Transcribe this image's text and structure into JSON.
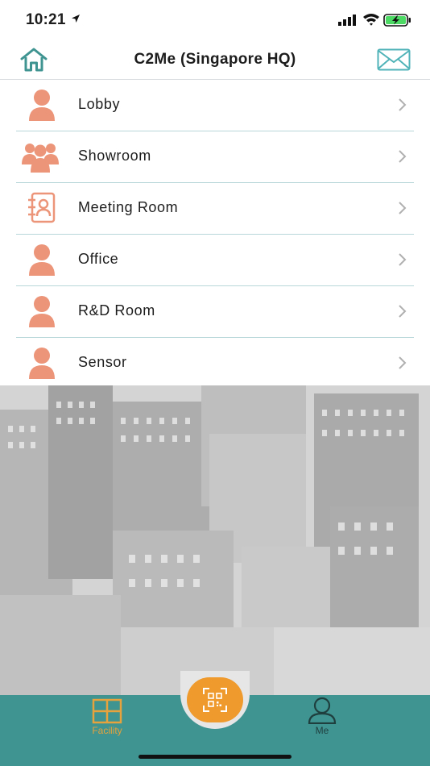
{
  "status_bar": {
    "time": "10:21"
  },
  "nav": {
    "title": "C2Me (Singapore HQ)"
  },
  "list": {
    "items": [
      {
        "label": "Lobby",
        "icon": "person-icon"
      },
      {
        "label": "Showroom",
        "icon": "group-icon"
      },
      {
        "label": "Meeting Room",
        "icon": "contact-book-icon"
      },
      {
        "label": "Office",
        "icon": "person-icon"
      },
      {
        "label": "R&D Room",
        "icon": "person-icon"
      },
      {
        "label": "Sensor",
        "icon": "person-icon"
      }
    ]
  },
  "tabs": {
    "facility_label": "Facility",
    "me_label": "Me",
    "active": "Facility"
  },
  "colors": {
    "accent": "#3f9491",
    "icon": "#ec9579",
    "active_tab": "#e5a23d",
    "scan_button": "#ef9a2c"
  }
}
